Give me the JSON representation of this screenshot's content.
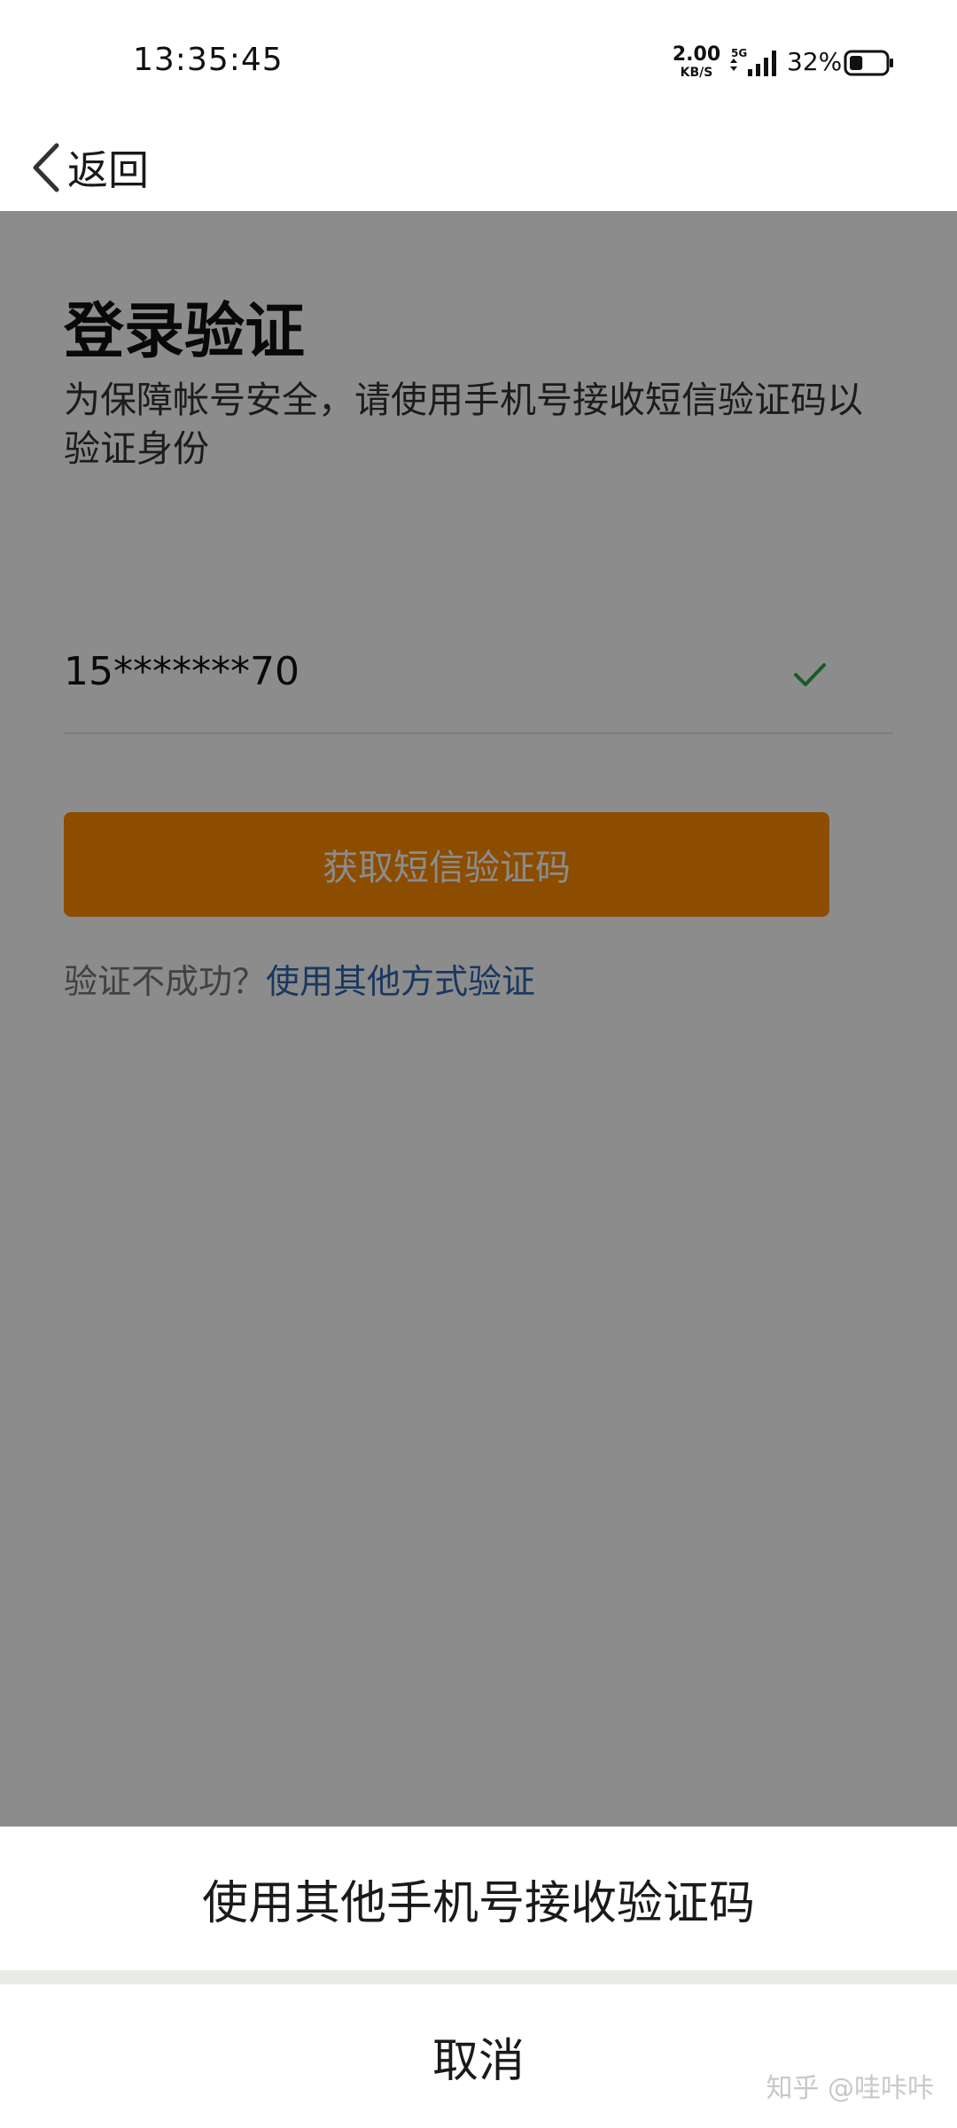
{
  "status_bar": {
    "time": "13:35:45",
    "net_speed_value": "2.00",
    "net_speed_unit": "KB/S",
    "network_type": "5G",
    "battery_percent": "32%",
    "battery_level": 0.32
  },
  "nav": {
    "back_label": "返回",
    "back_icon": "chevron-left-icon"
  },
  "main": {
    "title": "登录验证",
    "description": "为保障帐号安全，请使用手机号接收短信验证码以验证身份",
    "phone_masked": "15*******70",
    "verified_icon": "check-icon",
    "sms_button_label": "获取短信验证码",
    "help_question": "验证不成功？",
    "help_link": "使用其他方式验证"
  },
  "action_sheet": {
    "option_label": "使用其他手机号接收验证码",
    "cancel_label": "取消"
  },
  "watermark": "知乎 @哇咔咔",
  "colors": {
    "accent": "#ff8c00",
    "link": "#2e66b0",
    "check": "#2aa84a"
  }
}
